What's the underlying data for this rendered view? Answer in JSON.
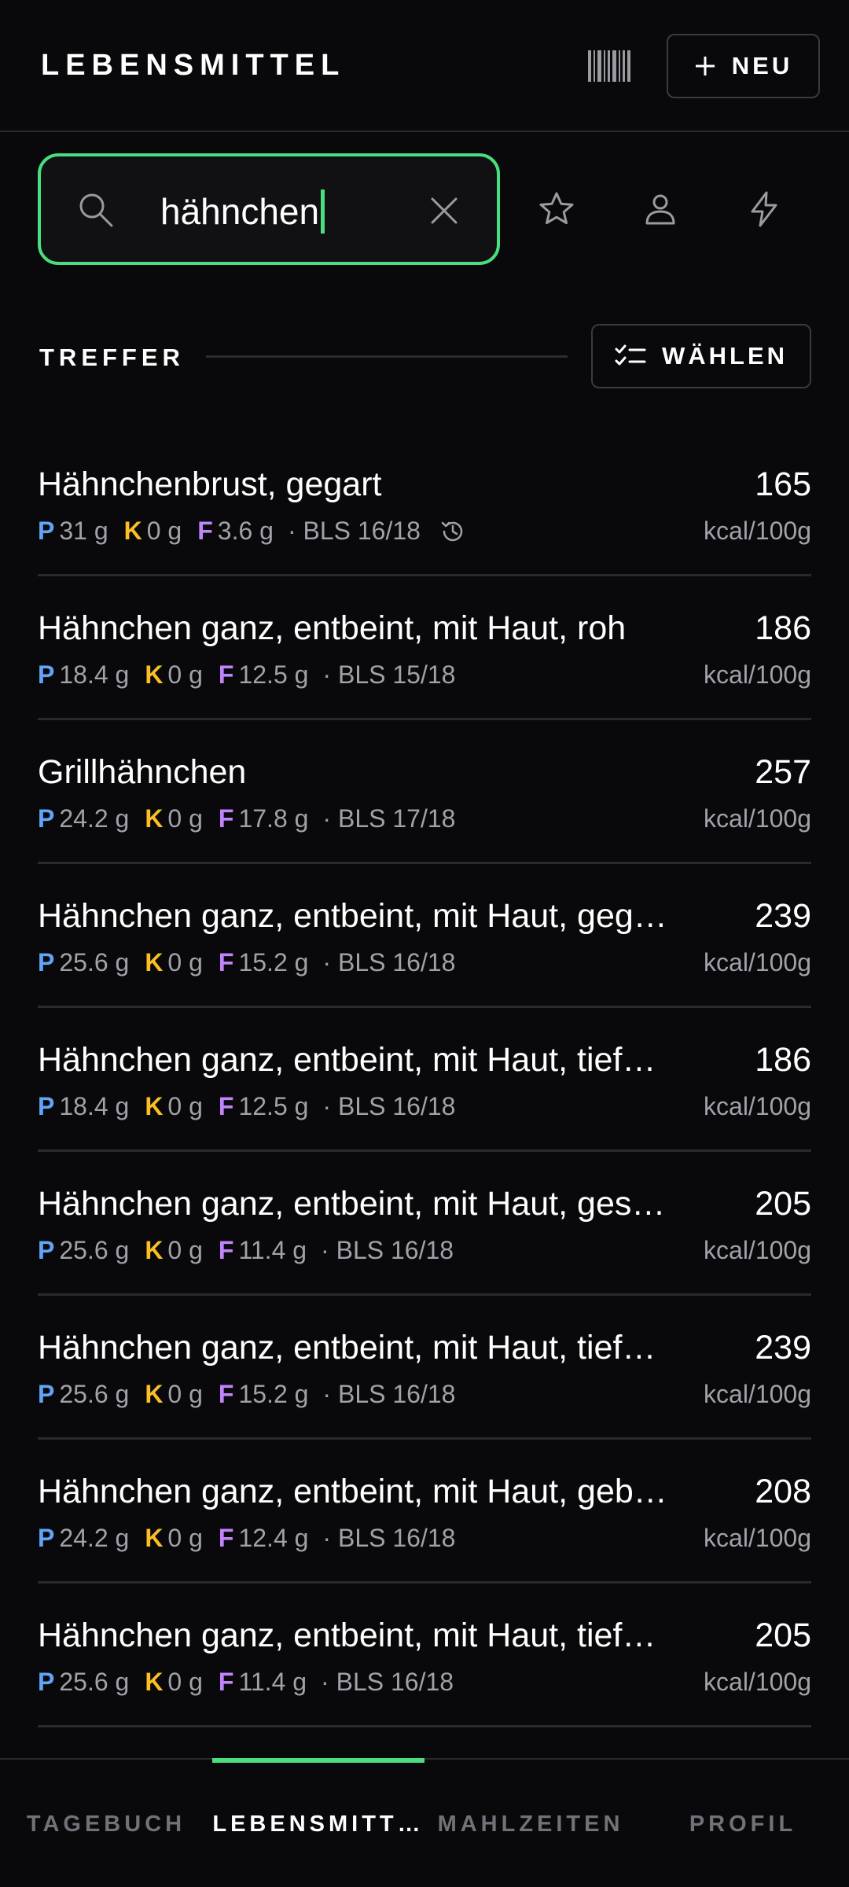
{
  "header": {
    "title": "LEBENSMITTEL",
    "new_label": "NEU"
  },
  "search": {
    "value": "hähnchen"
  },
  "results": {
    "label": "TREFFER",
    "select_label": "WÄHLEN",
    "items": [
      {
        "name": "Hähnchenbrust, gegart",
        "kcal": "165",
        "unit": "kcal/100g",
        "p": "31 g",
        "k": "0 g",
        "f": "3.6 g",
        "source": "· BLS 16/18",
        "history": true
      },
      {
        "name": "Hähnchen ganz, entbeint, mit Haut, roh",
        "kcal": "186",
        "unit": "kcal/100g",
        "p": "18.4 g",
        "k": "0 g",
        "f": "12.5 g",
        "source": "· BLS 15/18",
        "history": false
      },
      {
        "name": "Grillhähnchen",
        "kcal": "257",
        "unit": "kcal/100g",
        "p": "24.2 g",
        "k": "0 g",
        "f": "17.8 g",
        "source": "· BLS 17/18",
        "history": false
      },
      {
        "name": "Hähnchen ganz, entbeint, mit Haut, geg…",
        "kcal": "239",
        "unit": "kcal/100g",
        "p": "25.6 g",
        "k": "0 g",
        "f": "15.2 g",
        "source": "· BLS 16/18",
        "history": false
      },
      {
        "name": "Hähnchen ganz, entbeint, mit Haut, tief…",
        "kcal": "186",
        "unit": "kcal/100g",
        "p": "18.4 g",
        "k": "0 g",
        "f": "12.5 g",
        "source": "· BLS 16/18",
        "history": false
      },
      {
        "name": "Hähnchen ganz, entbeint, mit Haut, ges…",
        "kcal": "205",
        "unit": "kcal/100g",
        "p": "25.6 g",
        "k": "0 g",
        "f": "11.4 g",
        "source": "· BLS 16/18",
        "history": false
      },
      {
        "name": "Hähnchen ganz, entbeint, mit Haut, tief…",
        "kcal": "239",
        "unit": "kcal/100g",
        "p": "25.6 g",
        "k": "0 g",
        "f": "15.2 g",
        "source": "· BLS 16/18",
        "history": false
      },
      {
        "name": "Hähnchen ganz, entbeint, mit Haut, geb…",
        "kcal": "208",
        "unit": "kcal/100g",
        "p": "24.2 g",
        "k": "0 g",
        "f": "12.4 g",
        "source": "· BLS 16/18",
        "history": false
      },
      {
        "name": "Hähnchen ganz, entbeint, mit Haut, tief…",
        "kcal": "205",
        "unit": "kcal/100g",
        "p": "25.6 g",
        "k": "0 g",
        "f": "11.4 g",
        "source": "· BLS 16/18",
        "history": false
      }
    ]
  },
  "macro_letters": {
    "p": "P",
    "k": "K",
    "f": "F"
  },
  "nav": {
    "tabs": [
      {
        "label": "TAGEBUCH",
        "active": false
      },
      {
        "label": "LEBENSMITT…",
        "active": true
      },
      {
        "label": "MAHLZEITEN",
        "active": false
      },
      {
        "label": "PROFIL",
        "active": false
      }
    ]
  },
  "colors": {
    "accent": "#4ade80",
    "protein": "#60a5fa",
    "carbs": "#fbbf24",
    "fat": "#c084fc",
    "background": "#09090b"
  },
  "icons": [
    "barcode-icon",
    "plus-icon",
    "search-icon",
    "clear-icon",
    "star-icon",
    "user-icon",
    "bolt-icon",
    "checklist-icon",
    "history-icon"
  ]
}
